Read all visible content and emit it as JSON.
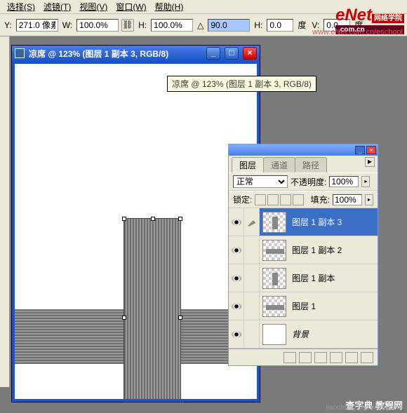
{
  "menubar": {
    "items": [
      "选择(S)",
      "滤镜(T)",
      "视图(V)",
      "窗口(W)",
      "帮助(H)"
    ]
  },
  "optbar": {
    "y_label": "Y:",
    "y_value": "271.0 像素",
    "w_label": "W:",
    "w_value": "100.0%",
    "h_label": "H:",
    "h_value": "100.0%",
    "angle_icon": "△",
    "angle_value": "90.0",
    "h2_label": "H:",
    "h2_value": "0.0",
    "deg_label": "度",
    "v_label": "V:",
    "v_value": "0.0",
    "deg_label2": "度"
  },
  "watermark": {
    "big": "eNet",
    "tag": "网络学院",
    "sub": ".com.cn",
    "url": "www.eNet.com.cn/eschool"
  },
  "doc": {
    "title": "凉席 @ 123% (图层 1 副本 3, RGB/8)"
  },
  "tooltip": "凉席 @ 123% (图层 1 副本 3, RGB/8)",
  "panel": {
    "tabs": [
      "图层",
      "通道",
      "路径"
    ],
    "opacity_label": "不透明度:",
    "opacity_value": "100%",
    "mode": "正常",
    "lock_label": "锁定:",
    "fill_label": "填充:",
    "fill_value": "100%",
    "layers": [
      {
        "name": "图层 1 副本 3",
        "selected": true
      },
      {
        "name": "图层 1 副本 2",
        "selected": false
      },
      {
        "name": "图层 1 副本",
        "selected": false
      },
      {
        "name": "图层 1",
        "selected": false
      },
      {
        "name": "背景",
        "selected": false,
        "bg": true
      }
    ]
  },
  "source": {
    "text": "查字典 教程网",
    "url": "jiaocheng.chazidian.com"
  }
}
